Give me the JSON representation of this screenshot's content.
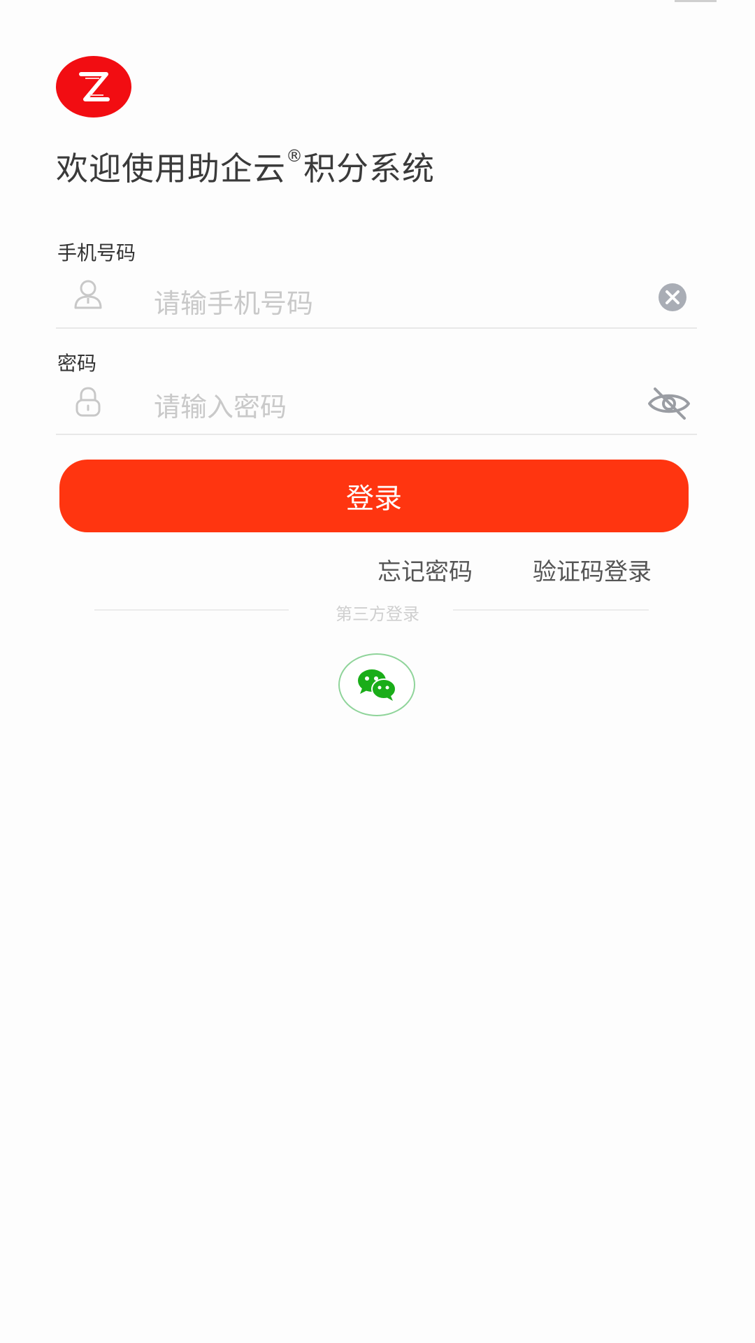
{
  "app": {
    "welcome_title": "欢迎使用助企云",
    "registered_mark": "®",
    "welcome_suffix": "积分系统",
    "brand_color": "#f20d12",
    "logo_letter": "Z"
  },
  "form": {
    "phone_label": "手机号码",
    "phone_placeholder": "请输手机号码",
    "phone_value": "",
    "password_label": "密码",
    "password_placeholder": "请输入密码",
    "password_value": "",
    "login_label": "登录",
    "login_color": "#ff3510"
  },
  "links": {
    "forgot_password": "忘记密码",
    "sms_login": "验证码登录"
  },
  "third_party": {
    "label": "第三方登录",
    "providers": [
      "wechat"
    ],
    "wechat_color": "#1aad19"
  },
  "icons": {
    "phone_field": "user-icon",
    "phone_clear": "clear-icon",
    "password_field": "lock-icon",
    "password_toggle": "eye-off-icon",
    "wechat": "wechat-icon"
  }
}
